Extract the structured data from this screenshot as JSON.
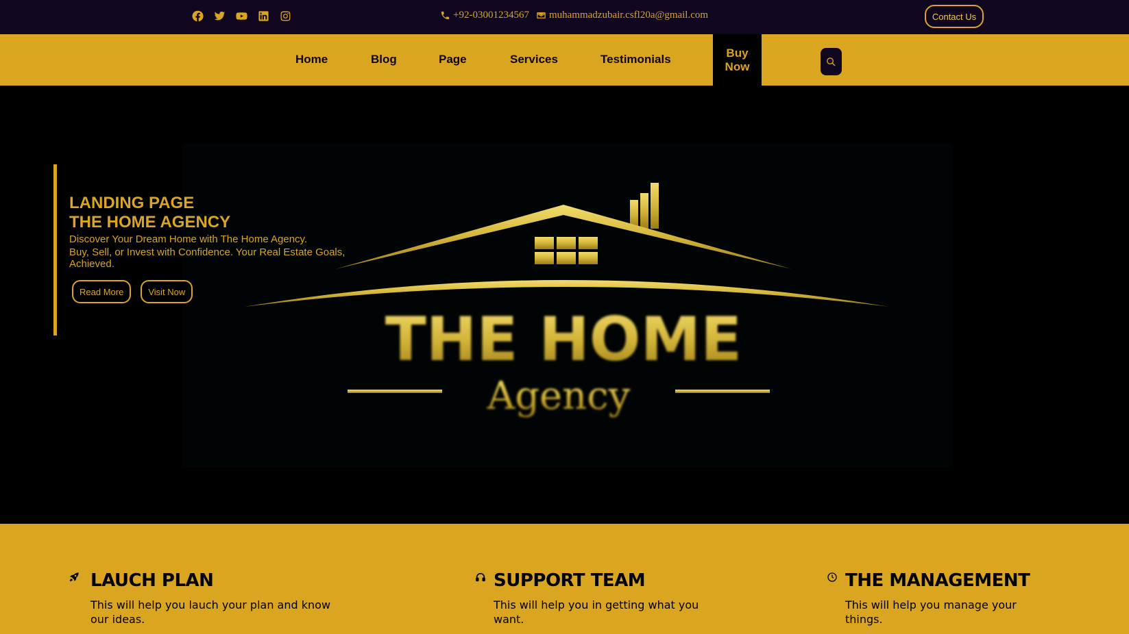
{
  "topbar": {
    "socials": [
      "facebook-icon",
      "twitter-icon",
      "youtube-icon",
      "linkedin-icon",
      "instagram-icon"
    ],
    "phone": "+92-03001234567",
    "email": "muhammadzubair.csfl20a@gmail.com",
    "contact_button": "Contact Us"
  },
  "nav": {
    "items": [
      "Home",
      "Blog",
      "Page",
      "Services",
      "Testimonials"
    ],
    "buy_now_line1": "Buy",
    "buy_now_line2": "Now"
  },
  "hero": {
    "title_line1": "LANDING PAGE",
    "title_line2": "THE HOME AGENCY",
    "desc_line1": "Discover Your Dream Home with The Home Agency.",
    "desc_line2": "Buy, Sell, or Invest with Confidence. Your Real Estate Goals, Achieved.",
    "read_more": "Read More",
    "visit_now": "Visit Now",
    "logo_text": "THE HOME",
    "logo_subtext": "Agency"
  },
  "features": [
    {
      "icon": "rocket-icon",
      "title": "LAUCH PLAN",
      "desc": "This will help you lauch your plan and know our ideas."
    },
    {
      "icon": "headphones-icon",
      "title": "SUPPORT TEAM",
      "desc": "This will help you in getting what you want."
    },
    {
      "icon": "clock-icon",
      "title": "THE MANAGEMENT",
      "desc": "This will help you manage your things."
    }
  ],
  "colors": {
    "gold": "#daa520",
    "dark": "#10061f",
    "black": "#000000"
  }
}
